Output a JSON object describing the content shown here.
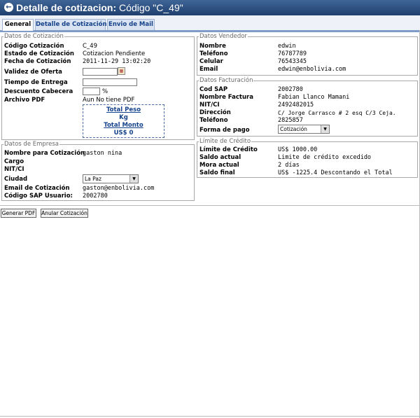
{
  "header": {
    "back_icon": "arrow-left-icon",
    "title_bold": "Detalle de cotizacion:",
    "title_rest": " Código \"C_49\""
  },
  "tabs": [
    {
      "label": "General",
      "active": true
    },
    {
      "label": "Detalle de Cotización",
      "active": false
    },
    {
      "label": "Envio de Mail",
      "active": false
    }
  ],
  "cotizacion": {
    "legend": "Datos de Cotización",
    "codigo_label": "Código Cotización",
    "codigo_value": "C_49",
    "estado_label": "Estado de Cotización",
    "estado_value": "Cotizacion Pendiente",
    "fecha_label": "Fecha de Cotización",
    "fecha_value": "2011-11-29 13:02:20",
    "validez_label": "Validez de Oferta",
    "validez_value": "",
    "tiempo_label": "Tiempo de Entrega",
    "tiempo_value": "",
    "descuento_label": "Descuento Cabecera",
    "descuento_value": "",
    "descuento_unit": "%",
    "archivo_label": "Archivo PDF",
    "archivo_value": "Aun No tiene PDF",
    "total_peso_label": "Total Peso",
    "total_peso_unit": "Kg",
    "total_monto_label": "Total Monto",
    "total_monto_value": "US$ 0"
  },
  "empresa": {
    "legend": "Datos de Empresa",
    "nombre_label": "Nombre para Cotización",
    "nombre_value": "gaston nina",
    "cargo_label": "Cargo",
    "nit_label": "NIT/CI",
    "ciudad_label": "Ciudad",
    "ciudad_value": "La Paz",
    "email_label": "Email de Cotización",
    "email_value": "gaston@enbolivia.com",
    "sap_label": "Código SAP Usuario:",
    "sap_value": "2002780"
  },
  "vendedor": {
    "legend": "Datos Vendedor",
    "nombre_label": "Nombre",
    "nombre_value": "edwin",
    "telefono_label": "Teléfono",
    "telefono_value": "76787789",
    "celular_label": "Celular",
    "celular_value": "76543345",
    "email_label": "Email",
    "email_value": "edwin@enbolivia.com"
  },
  "facturacion": {
    "legend": "Datos Facturación",
    "sap_label": "Cod SAP",
    "sap_value": "2002780",
    "nombre_label": "Nombre Factura",
    "nombre_value": "Fabian Llanco Mamani",
    "nit_label": "NIT/CI",
    "nit_value": "2492482015",
    "direccion_label": "Dirección",
    "direccion_value": "C/ Jorge Carrasco # 2 esq C/3 Ceja.",
    "telefono_label": "Teléfono",
    "telefono_value": "2825857",
    "pago_label": "Forma de pago",
    "pago_value": "Cotización"
  },
  "credito": {
    "legend": "Límite de Crédito",
    "limite_label": "Límite de Crédito",
    "limite_value": "US$ 1000.00",
    "saldo_label": "Saldo actual",
    "saldo_value": "Limite de crédito excedido",
    "mora_label": "Mora actual",
    "mora_value": "2 días",
    "final_label": "Saldo final",
    "final_value": "US$ -1225.4 Descontando el Total"
  },
  "buttons": {
    "generar": "Generar PDF",
    "anular": "Anular Cotización"
  }
}
